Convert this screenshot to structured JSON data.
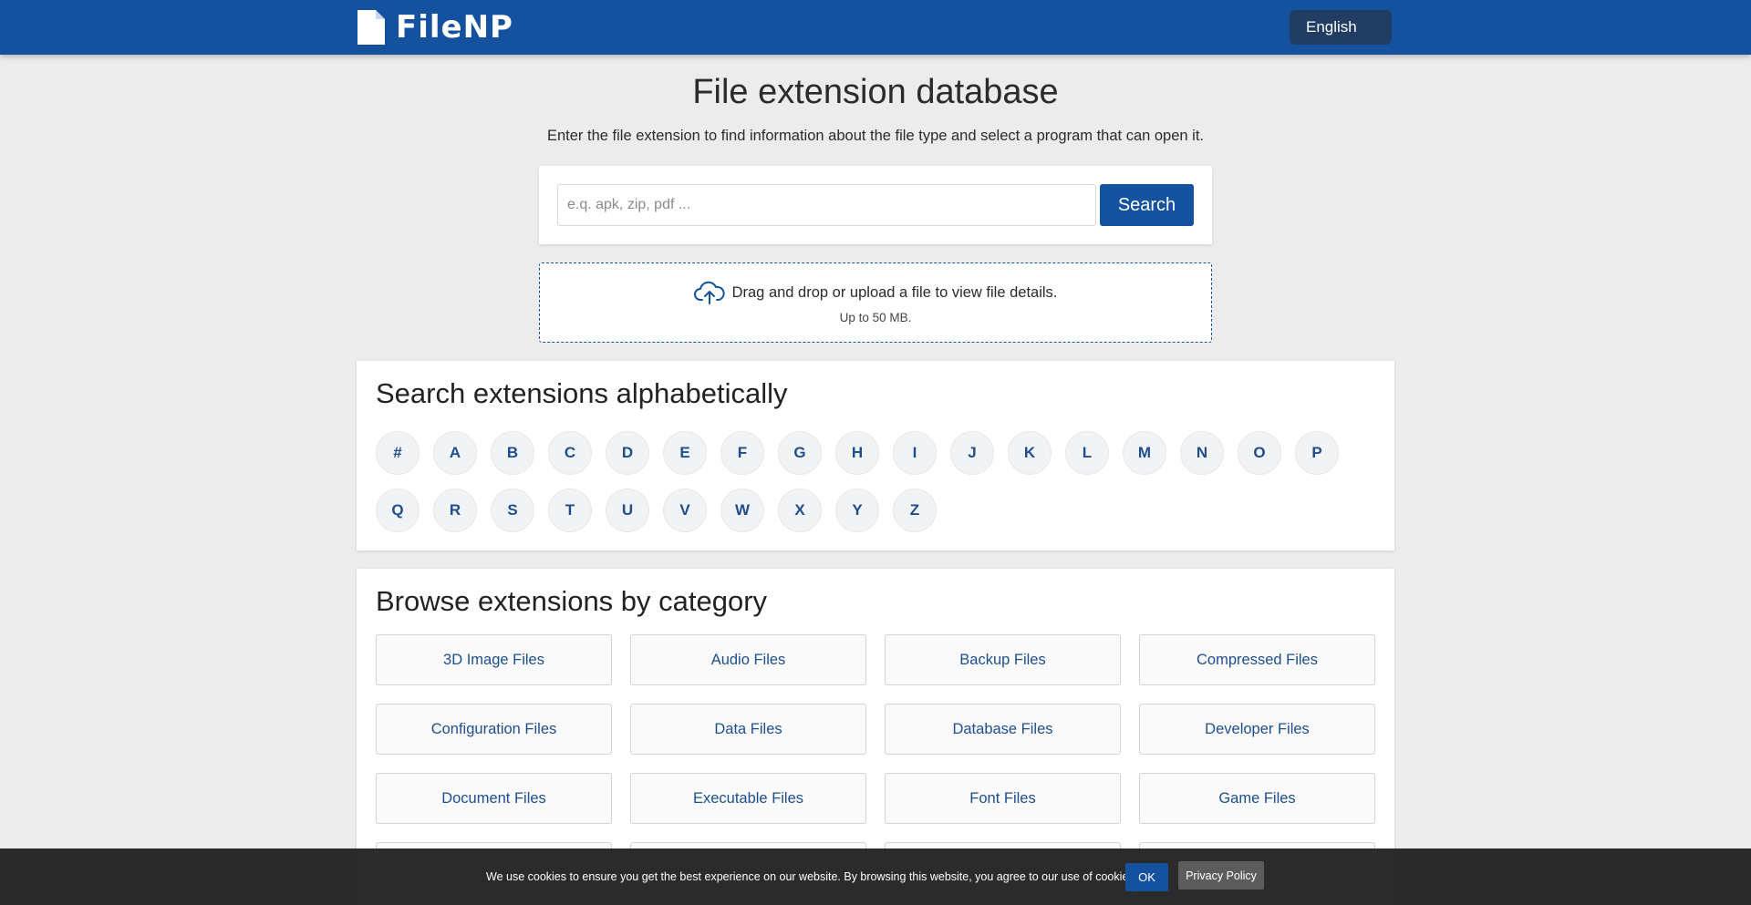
{
  "header": {
    "brand": "FileNP",
    "brand_icon": "document-icon",
    "language": "English",
    "background": "#1452a0"
  },
  "hero": {
    "title": "File extension database",
    "subtitle": "Enter the file extension to find information about the file type and select a program that can open it."
  },
  "search": {
    "placeholder": "e.q. apk, zip, pdf ...",
    "value": "",
    "button_label": "Search"
  },
  "upload": {
    "icon": "cloud-upload-icon",
    "text": "Drag and drop or upload a file to view file details.",
    "limit": "Up to 50 MB."
  },
  "alphabet": {
    "title": "Search extensions alphabetically",
    "letters": [
      "#",
      "A",
      "B",
      "C",
      "D",
      "E",
      "F",
      "G",
      "H",
      "I",
      "J",
      "K",
      "L",
      "M",
      "N",
      "O",
      "P",
      "Q",
      "R",
      "S",
      "T",
      "U",
      "V",
      "W",
      "X",
      "Y",
      "Z"
    ]
  },
  "categories": {
    "title": "Browse extensions by category",
    "items": [
      "3D Image Files",
      "Audio Files",
      "Backup Files",
      "Compressed Files",
      "Configuration Files",
      "Data Files",
      "Database Files",
      "Developer Files",
      "Document Files",
      "Executable Files",
      "Font Files",
      "Game Files"
    ]
  },
  "cookie": {
    "text": "We use cookies to ensure you get the best experience on our website. By browsing this website, you agree to our use of cookies.",
    "ok_label": "OK",
    "privacy_label": "Privacy Policy"
  }
}
